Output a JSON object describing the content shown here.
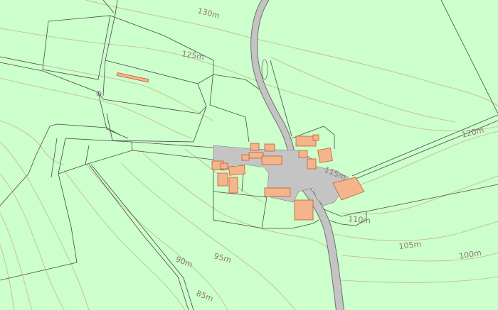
{
  "map": {
    "background_color": "#ccffcc",
    "contour_color": "#c9b48a",
    "building_color": "#f4b48c",
    "road_color": "#c4c4c4",
    "contour_labels": {
      "c130": "130m",
      "c125": "125m",
      "c120": "120m",
      "c115": "115m",
      "c110": "110m",
      "c105": "105m",
      "c100": "100m",
      "c95": "95m",
      "c90": "90m",
      "c85": "85m"
    }
  }
}
